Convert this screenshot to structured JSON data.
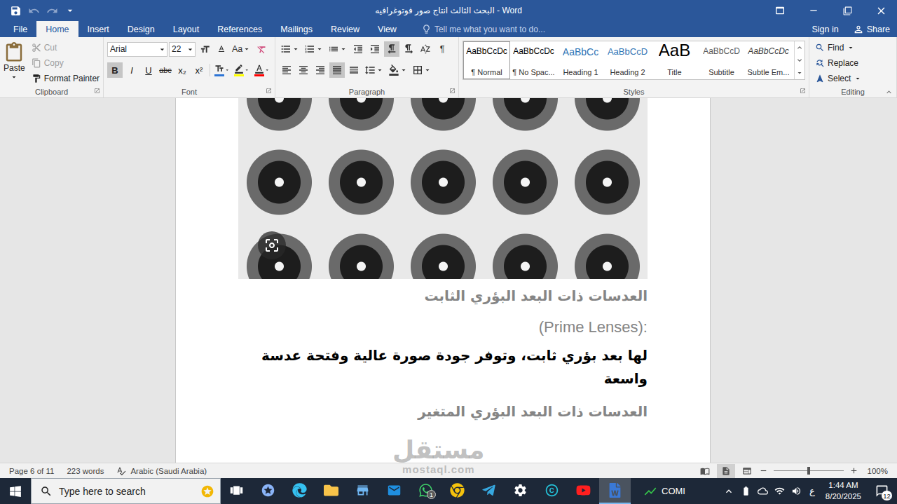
{
  "window": {
    "title": "البحث الثالث انتاج صور فوتوغرافيه - Word"
  },
  "tabs": [
    {
      "label": "File",
      "selected": false
    },
    {
      "label": "Home",
      "selected": true
    },
    {
      "label": "Insert",
      "selected": false
    },
    {
      "label": "Design",
      "selected": false
    },
    {
      "label": "Layout",
      "selected": false
    },
    {
      "label": "References",
      "selected": false
    },
    {
      "label": "Mailings",
      "selected": false
    },
    {
      "label": "Review",
      "selected": false
    },
    {
      "label": "View",
      "selected": false
    }
  ],
  "tell_me": {
    "placeholder": "Tell me what you want to do..."
  },
  "account": {
    "sign_in": "Sign in",
    "share": "Share"
  },
  "clipboard": {
    "label": "Clipboard",
    "launcher": true,
    "paste": "Paste",
    "items": [
      {
        "label": "Cut",
        "kind": "cut",
        "disabled": true
      },
      {
        "label": "Copy",
        "kind": "copy",
        "disabled": true
      },
      {
        "label": "Format Painter",
        "kind": "painter",
        "disabled": false
      }
    ]
  },
  "font": {
    "label": "Font",
    "launcher": true,
    "name": "Arial",
    "size": "22",
    "case_button": "Aa",
    "formats": [
      {
        "label": "B",
        "kind": "bold",
        "selected": true
      },
      {
        "label": "I",
        "kind": "italic",
        "selected": false
      },
      {
        "label": "U",
        "kind": "underline",
        "selected": false
      },
      {
        "label": "abc",
        "kind": "strike",
        "selected": false
      },
      {
        "label": "x₂",
        "kind": "sub",
        "selected": false
      },
      {
        "label": "x²",
        "kind": "sup",
        "selected": false
      }
    ],
    "colors": [
      {
        "kind": "effects",
        "color": "#2e75d6"
      },
      {
        "kind": "highlight",
        "color": "#ffff00"
      },
      {
        "kind": "font-color",
        "color": "#ff0000"
      }
    ]
  },
  "paragraph": {
    "label": "Paragraph",
    "launcher": true,
    "row1": [
      {
        "kind": "bullets",
        "selected": false,
        "dropdown": true
      },
      {
        "kind": "numbering",
        "selected": false,
        "dropdown": true
      },
      {
        "kind": "multilevel",
        "selected": false,
        "dropdown": true
      },
      {
        "kind": "outdent",
        "selected": false,
        "dropdown": false
      },
      {
        "kind": "indent",
        "selected": false,
        "dropdown": false
      },
      {
        "kind": "rtl",
        "selected": true,
        "dropdown": false
      },
      {
        "kind": "ltr",
        "selected": false,
        "dropdown": false
      },
      {
        "kind": "sort",
        "selected": false,
        "dropdown": false
      }
    ],
    "show_marks": {
      "label": "¶",
      "selected": false
    },
    "row2": [
      {
        "kind": "align-left",
        "selected": false,
        "dropdown": false
      },
      {
        "kind": "align-center",
        "selected": false,
        "dropdown": false
      },
      {
        "kind": "align-right",
        "selected": false,
        "dropdown": false
      },
      {
        "kind": "justify",
        "selected": true,
        "dropdown": false
      },
      {
        "kind": "distributed",
        "selected": false,
        "dropdown": false
      },
      {
        "kind": "line-spacing",
        "selected": false,
        "dropdown": true
      },
      {
        "kind": "shading",
        "selected": false,
        "dropdown": true
      },
      {
        "kind": "borders",
        "selected": false,
        "dropdown": true
      }
    ]
  },
  "styles": {
    "label": "Styles",
    "launcher": true,
    "items": [
      {
        "preview": "AaBbCcDc",
        "name": "¶ Normal",
        "kind": "normal",
        "selected": true
      },
      {
        "preview": "AaBbCcDc",
        "name": "¶ No Spac...",
        "kind": "normal",
        "selected": false
      },
      {
        "preview": "AaBbCc",
        "name": "Heading 1",
        "kind": "heading1",
        "selected": false
      },
      {
        "preview": "AaBbCcD",
        "name": "Heading 2",
        "kind": "heading2",
        "selected": false
      },
      {
        "preview": "AaB",
        "name": "Title",
        "kind": "title",
        "selected": false
      },
      {
        "preview": "AaBbCcD",
        "name": "Subtitle",
        "kind": "subtitle",
        "selected": false
      },
      {
        "preview": "AaBbCcDc",
        "name": "Subtle Em...",
        "kind": "emphasis",
        "selected": false
      }
    ]
  },
  "editing": {
    "label": "Editing",
    "launcher": false,
    "items": [
      {
        "label": "Find",
        "kind": "find",
        "dropdown": true
      },
      {
        "label": "Replace",
        "kind": "replace",
        "dropdown": false
      },
      {
        "label": "Select",
        "kind": "select",
        "dropdown": true
      }
    ]
  },
  "document": {
    "paragraphs": [
      {
        "text": "العدسات ذات البعد البؤري الثابت",
        "kind": "heading"
      },
      {
        "text": "(Prime Lenses):",
        "kind": "latin"
      },
      {
        "text": "لها بعد بؤري ثابت، وتوفر جودة صورة عالية وفتحة عدسة واسعة",
        "kind": "body"
      },
      {
        "text": "العدسات ذات البعد البؤري المتغير",
        "kind": "heading"
      }
    ]
  },
  "status_bar": {
    "page": "Page 6 of 11",
    "words": "223 words",
    "language": "Arabic (Saudi Arabia)",
    "views": [
      {
        "kind": "read",
        "selected": false
      },
      {
        "kind": "print",
        "selected": true
      },
      {
        "kind": "web",
        "selected": false
      }
    ],
    "zoom": {
      "level": 0.5,
      "reading": "100%"
    }
  },
  "taskbar": {
    "search": {
      "placeholder": "Type here to search"
    },
    "apps": [
      {
        "kind": "taskview",
        "color": "#ffffff",
        "selected": false,
        "badge": ""
      },
      {
        "kind": "copilot",
        "color": "#8ab4f8",
        "selected": false,
        "badge": ""
      },
      {
        "kind": "edge",
        "color": "#35c1f1",
        "selected": false,
        "badge": ""
      },
      {
        "kind": "explorer",
        "color": "#f8c44a",
        "selected": false,
        "badge": ""
      },
      {
        "kind": "store",
        "color": "#6fb6f2",
        "selected": false,
        "badge": ""
      },
      {
        "kind": "outlook",
        "color": "#1f8fe0",
        "selected": false,
        "badge": ""
      },
      {
        "kind": "whatsapp",
        "color": "#3fd36a",
        "selected": false,
        "badge": "1"
      },
      {
        "kind": "chrome",
        "color": "#f4c20d",
        "selected": false,
        "badge": ""
      },
      {
        "kind": "telegram",
        "color": "#36a8e0",
        "selected": false,
        "badge": ""
      },
      {
        "kind": "settings",
        "color": "#ffffff",
        "selected": false,
        "badge": ""
      },
      {
        "kind": "canva",
        "color": "#25c1d8",
        "selected": false,
        "badge": ""
      },
      {
        "kind": "youtube",
        "color": "#ff1f1f",
        "selected": false,
        "badge": ""
      },
      {
        "kind": "word",
        "color": "#3a79d6",
        "selected": true,
        "badge": ""
      }
    ],
    "pinned": {
      "label": "COMI",
      "color": "#35c24a"
    },
    "tray": {
      "input": "ع",
      "time": "1:44 AM",
      "date": "8/20/2025",
      "notifications": "12"
    }
  },
  "watermark": {
    "name": "مستقل",
    "url": "mostaql.com"
  }
}
